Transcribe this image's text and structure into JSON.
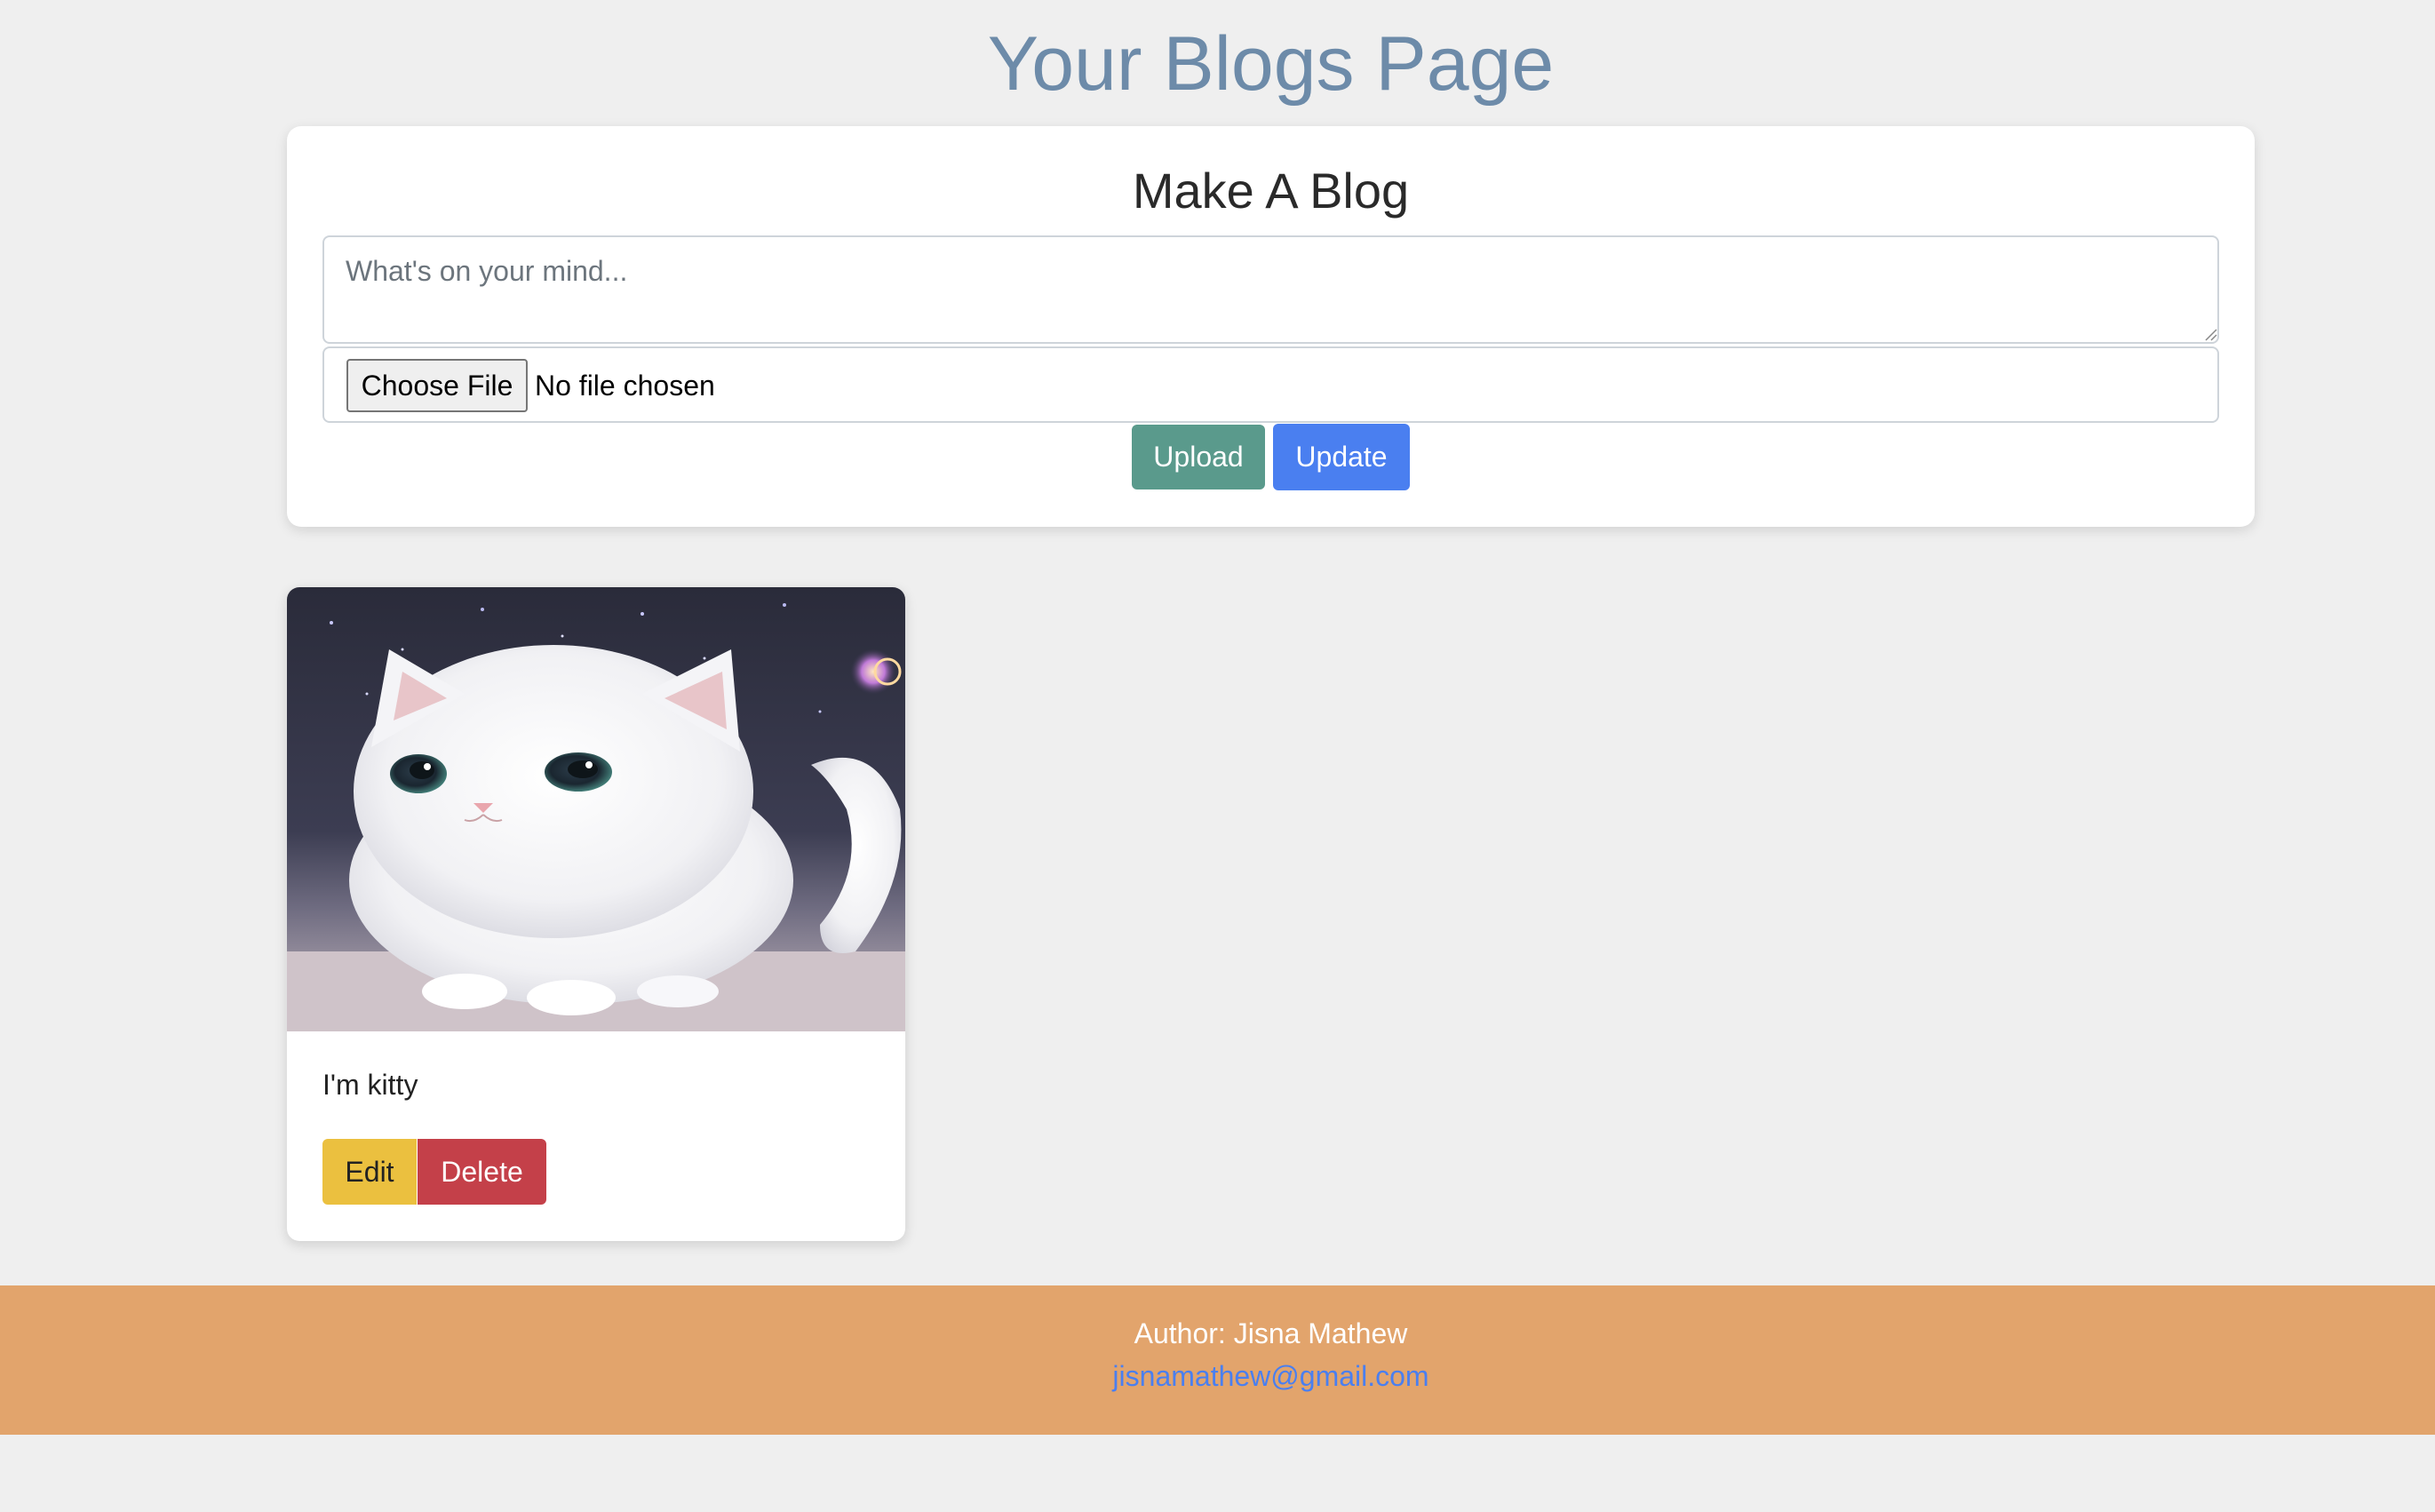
{
  "page": {
    "title": "Your Blogs Page"
  },
  "composer": {
    "heading": "Make A Blog",
    "textarea_placeholder": "What's on your mind...",
    "textarea_value": "",
    "file_button_label": "Choose File",
    "file_status": "No file chosen",
    "upload_label": "Upload",
    "update_label": "Update"
  },
  "posts": [
    {
      "text": "I'm kitty",
      "edit_label": "Edit",
      "delete_label": "Delete"
    }
  ],
  "footer": {
    "author": "Author: Jisna Mathew",
    "email": "jisnamathew@gmail.com"
  },
  "colors": {
    "background": "#efefef",
    "title": "#6d8ba9",
    "upload": "#5a9a8c",
    "update": "#4a7ff0",
    "edit": "#ebc03f",
    "delete": "#c44049",
    "footer": "#e2a46c",
    "link": "#4a7ff0"
  }
}
